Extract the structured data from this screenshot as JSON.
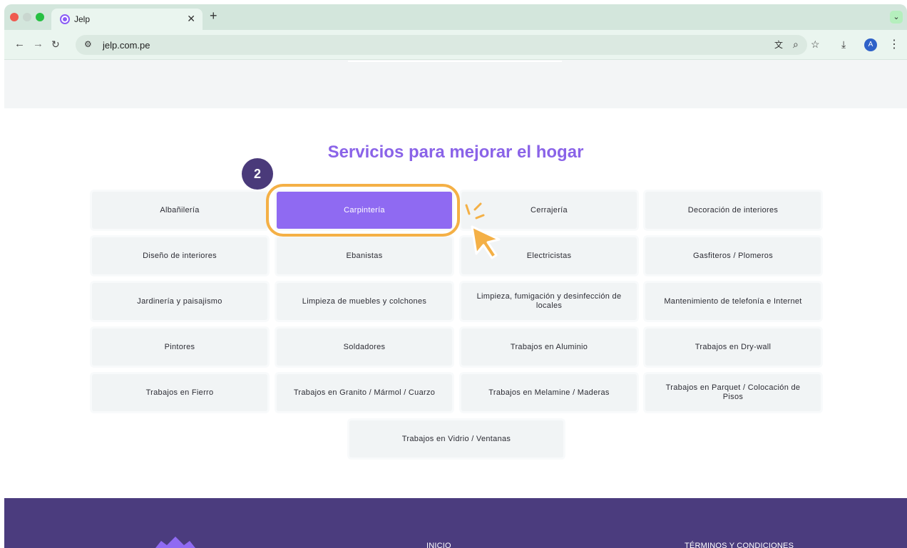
{
  "browser": {
    "tab": {
      "title": "Jelp"
    },
    "new_tab_label": "+",
    "url": "jelp.com.pe",
    "profile_initial": "A"
  },
  "page": {
    "section_title": "Servicios para mejorar el hogar",
    "services": [
      "Albañilería",
      "Carpintería",
      "Cerrajería",
      "Decoración de interiores",
      "Diseño de interiores",
      "Ebanistas",
      "Electricistas",
      "Gasfiteros / Plomeros",
      "Jardinería y paisajismo",
      "Limpieza de muebles y colchones",
      "Limpieza, fumigación y desinfección de locales",
      "Mantenimiento de telefonía e Internet",
      "Pintores",
      "Soldadores",
      "Trabajos en Aluminio",
      "Trabajos en Dry-wall",
      "Trabajos en Fierro",
      "Trabajos en Granito / Mármol / Cuarzo",
      "Trabajos en Melamine / Maderas",
      "Trabajos en Parquet / Colocación de Pisos",
      "Trabajos en Vidrio / Ventanas"
    ],
    "active_service": "Carpintería"
  },
  "tutorial": {
    "step_number": "2"
  },
  "footer": {
    "links": [
      "INICIO",
      "TÉRMINOS Y CONDICIONES"
    ]
  },
  "colors": {
    "accent_purple": "#8f6af2",
    "title_purple": "#8a63e8",
    "footer_purple": "#4b3c7e",
    "highlight_orange": "#f4b046"
  },
  "icons": {
    "back": "arrow-left-icon",
    "forward": "arrow-right-icon",
    "reload": "reload-icon",
    "site_info": "site-settings-icon",
    "translate": "translate-icon",
    "zoom": "zoom-icon",
    "bookmark": "star-icon",
    "download": "download-icon",
    "menu": "kebab-menu-icon",
    "cursor": "click-pointer-icon"
  }
}
